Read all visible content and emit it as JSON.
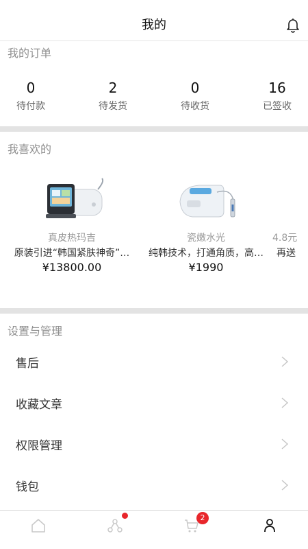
{
  "header": {
    "title": "我的",
    "bell_icon": "bell-icon"
  },
  "orders": {
    "title": "我的订单",
    "items": [
      {
        "count": "0",
        "label": "待付款"
      },
      {
        "count": "2",
        "label": "待发货"
      },
      {
        "count": "0",
        "label": "待收货"
      },
      {
        "count": "16",
        "label": "已签收"
      }
    ]
  },
  "favorites": {
    "title": "我喜欢的",
    "items": [
      {
        "name": "真皮热玛吉",
        "desc": "原装引进“韩国紧肤神奇”…",
        "price": "¥13800.00"
      },
      {
        "name": "瓷嫩水光",
        "desc": "纯韩技术，打通角质，高…",
        "price": "¥1990"
      },
      {
        "name": "4.8元",
        "desc": "再送 ",
        "price": ""
      }
    ]
  },
  "settings": {
    "title": "设置与管理",
    "items": [
      {
        "label": "售后"
      },
      {
        "label": "收藏文章"
      },
      {
        "label": "权限管理"
      },
      {
        "label": "钱包"
      }
    ]
  },
  "tabbar": {
    "tabs": [
      {
        "icon": "home-icon"
      },
      {
        "icon": "share-network-icon",
        "badge": "dot"
      },
      {
        "icon": "cart-icon",
        "badge_count": "2"
      },
      {
        "icon": "user-icon",
        "active": true
      }
    ]
  },
  "colors": {
    "badge": "#e8262b",
    "separator": "#e3e3e3",
    "muted_text": "#8e8e8e"
  }
}
